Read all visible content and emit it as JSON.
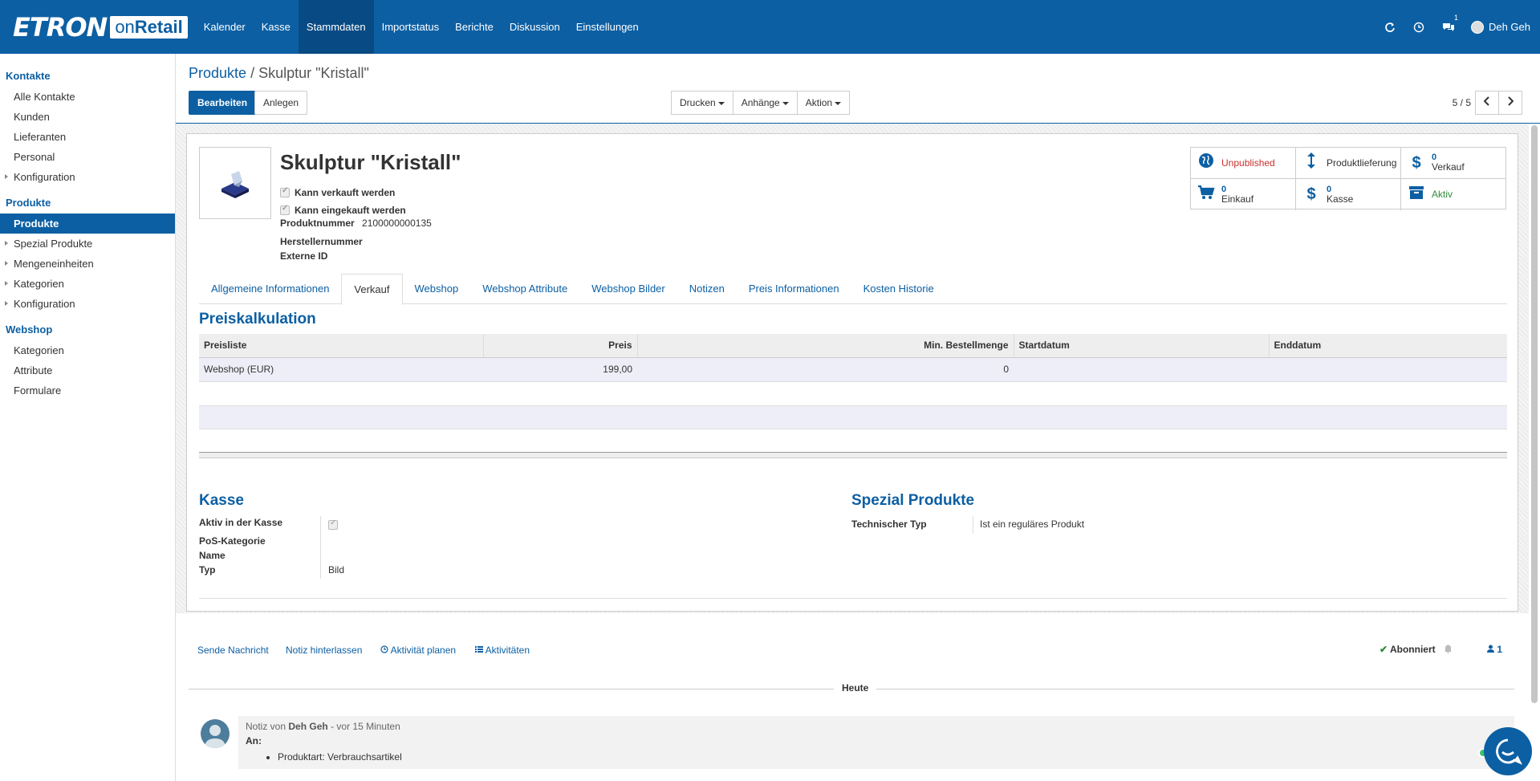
{
  "app": {
    "logo_main": "ETRON",
    "logo_on": "on",
    "logo_retail": "Retail"
  },
  "nav": [
    {
      "label": "Kalender"
    },
    {
      "label": "Kasse"
    },
    {
      "label": "Stammdaten"
    },
    {
      "label": "Importstatus"
    },
    {
      "label": "Berichte"
    },
    {
      "label": "Diskussion"
    },
    {
      "label": "Einstellungen"
    }
  ],
  "topright": {
    "messages_count": "1",
    "user_name": "Deh Geh"
  },
  "sidebar": {
    "kontakte": {
      "title": "Kontakte",
      "items": [
        "Alle Kontakte",
        "Kunden",
        "Lieferanten",
        "Personal",
        "Konfiguration"
      ]
    },
    "produkte": {
      "title": "Produkte",
      "items": [
        "Produkte",
        "Spezial Produkte",
        "Mengeneinheiten",
        "Kategorien",
        "Konfiguration"
      ]
    },
    "webshop": {
      "title": "Webshop",
      "items": [
        "Kategorien",
        "Attribute",
        "Formulare"
      ]
    }
  },
  "breadcrumb": {
    "parent": "Produkte",
    "separator": "/",
    "current": "Skulptur \"Kristall\""
  },
  "buttons": {
    "edit": "Bearbeiten",
    "create": "Anlegen",
    "print": "Drucken",
    "attachments": "Anhänge",
    "action": "Aktion"
  },
  "pager": {
    "value": "5 / 5"
  },
  "product": {
    "name": "Skulptur \"Kristall\"",
    "can_sell_label": "Kann verkauft werden",
    "can_purchase_label": "Kann eingekauft werden",
    "product_number_label": "Produktnummer",
    "product_number": "2100000000135",
    "manufacturer_number_label": "Herstellernummer",
    "external_id_label": "Externe ID"
  },
  "stats": {
    "unpublished": "Unpublished",
    "delivery": "Produktlieferung",
    "sales_count": "0",
    "sales_label": "Verkauf",
    "purchase_count": "0",
    "purchase_label": "Einkauf",
    "pos_count": "0",
    "pos_label": "Kasse",
    "active": "Aktiv"
  },
  "tabs": [
    {
      "label": "Allgemeine Informationen"
    },
    {
      "label": "Verkauf"
    },
    {
      "label": "Webshop"
    },
    {
      "label": "Webshop Attribute"
    },
    {
      "label": "Webshop Bilder"
    },
    {
      "label": "Notizen"
    },
    {
      "label": "Preis Informationen"
    },
    {
      "label": "Kosten Historie"
    }
  ],
  "pricing": {
    "title": "Preiskalkulation",
    "headers": [
      "Preisliste",
      "Preis",
      "Min. Bestellmenge",
      "Startdatum",
      "Enddatum"
    ],
    "rows": [
      {
        "pricelist": "Webshop (EUR)",
        "price": "199,00",
        "min_qty": "0",
        "start": "",
        "end": ""
      }
    ]
  },
  "kasse": {
    "title": "Kasse",
    "active_label": "Aktiv in der Kasse",
    "pos_category_label": "PoS-Kategorie",
    "name_label": "Name",
    "type_label": "Typ",
    "type_value": "Bild"
  },
  "special": {
    "title": "Spezial Produkte",
    "tech_type_label": "Technischer Typ",
    "tech_type_value": "Ist ein reguläres Produkt"
  },
  "chatter": {
    "send_message": "Sende Nachricht",
    "log_note": "Notiz hinterlassen",
    "schedule_activity": "Aktivität planen",
    "activities": "Aktivitäten",
    "subscribed": "Abonniert",
    "followers": "1",
    "today": "Heute",
    "message": {
      "prefix": "Notiz von",
      "author": "Deh Geh",
      "time": "- vor 15 Minuten",
      "to_label": "An:",
      "bullet": "Produktart: Verbrauchsartikel"
    }
  }
}
